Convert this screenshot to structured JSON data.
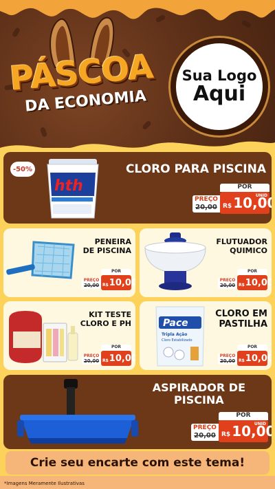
{
  "brand": {
    "title_main": "PÁSCOA",
    "title_sub": "DA ECONOMIA",
    "logo_line1": "Sua Logo",
    "logo_line2": "Aqui"
  },
  "products": [
    {
      "name": "CLORO PARA PISCINA",
      "badge": "-50%",
      "price_label": "PREÇO",
      "old_price": "20,00",
      "por": "POR",
      "currency": "R$",
      "new_price": "10,00",
      "unit": "UNID",
      "image": "hth-bucket-icon"
    },
    {
      "name": "PENEIRA\nDE PISCINA",
      "price_label": "PREÇO",
      "old_price": "20,00",
      "por": "POR",
      "currency": "R$",
      "new_price": "10,00",
      "image": "pool-net-icon"
    },
    {
      "name": "FLUTUADOR\nQUIMICO",
      "price_label": "PREÇO",
      "old_price": "20,00",
      "por": "POR",
      "currency": "R$",
      "new_price": "10,00",
      "image": "chlorine-floater-icon"
    },
    {
      "name": "KIT TESTE\nCLORO E PH",
      "price_label": "PREÇO",
      "old_price": "20,00",
      "por": "POR",
      "currency": "R$",
      "new_price": "10,00",
      "image": "test-kit-icon"
    },
    {
      "name": "CLORO EM\nPASTILHA",
      "price_label": "PREÇO",
      "old_price": "20,00",
      "por": "POR",
      "currency": "R$",
      "new_price": "10,00",
      "image": "pace-bag-icon"
    },
    {
      "name": "ASPIRADOR DE\nPISCINA",
      "price_label": "PREÇO",
      "old_price": "20,00",
      "por": "POR",
      "currency": "R$",
      "new_price": "10,00",
      "unit": "UNID",
      "image": "pool-vacuum-icon"
    }
  ],
  "pace_bag": {
    "brand": "Pace",
    "line1": "Tripla Ação",
    "line2": "Cloro Estabilizado"
  },
  "hth_bucket": {
    "brand": "hth"
  },
  "cta": "Crie seu encarte com este tema!",
  "disclaimer": "*Imagens Meramente Ilustrativas",
  "colors": {
    "accent": "#e0411c",
    "board": "#fcd25a",
    "chocolate": "#6d3818",
    "title": "#f5a623"
  }
}
